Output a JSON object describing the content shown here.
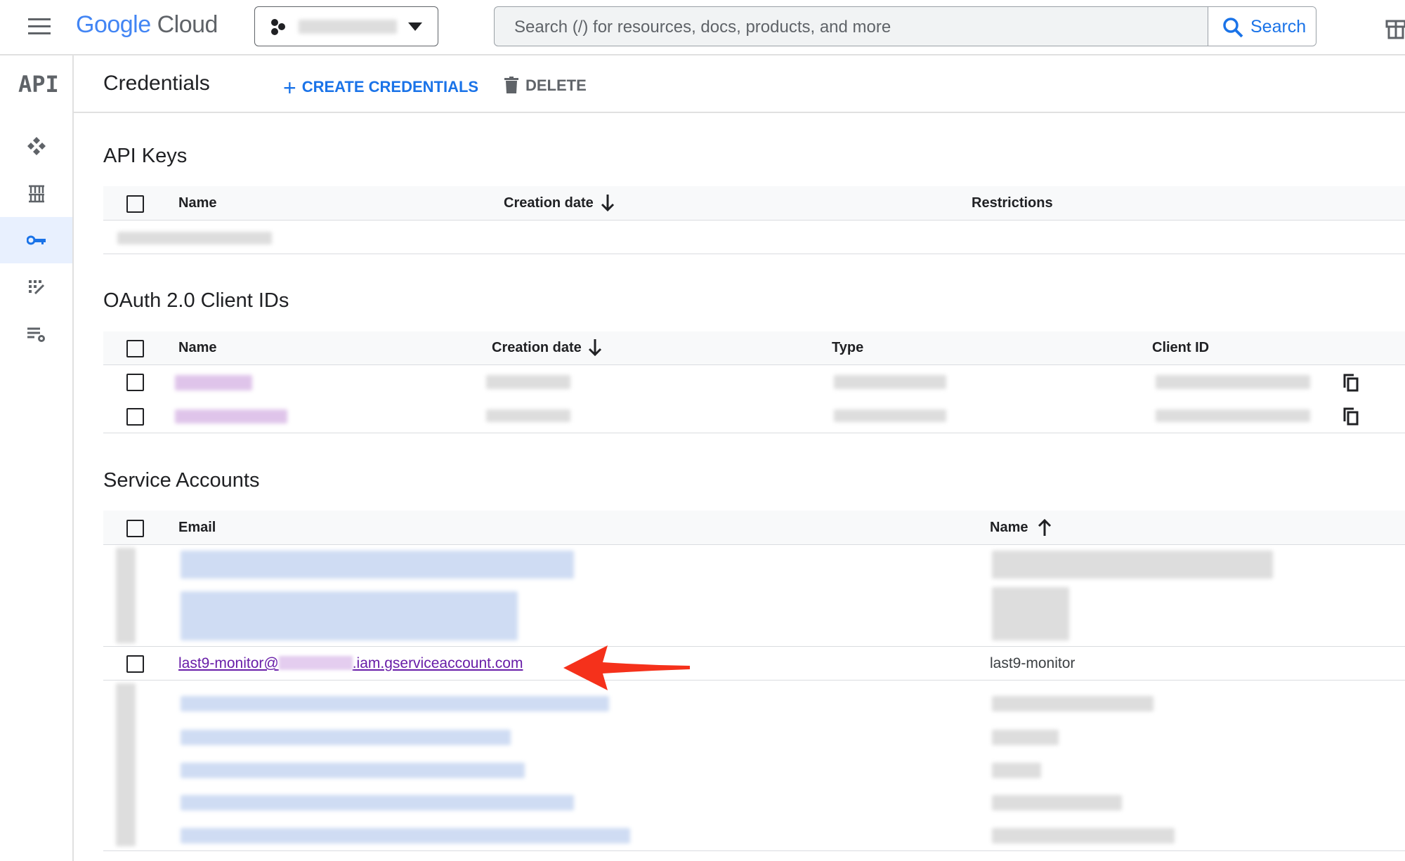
{
  "header": {
    "logo_google": "Google",
    "logo_cloud": "Cloud",
    "search_placeholder": "Search (/) for resources, docs, products, and more",
    "search_button": "Search"
  },
  "subbar": {
    "api_logo": "API",
    "title": "Credentials",
    "create_label": "CREATE CREDENTIALS",
    "delete_label": "DELETE"
  },
  "sidebar": {
    "items": [
      "dashboard",
      "library",
      "credentials",
      "oauth-consent",
      "page-usage-agreements"
    ]
  },
  "api_keys": {
    "title": "API Keys",
    "columns": [
      "Name",
      "Creation date",
      "Restrictions"
    ]
  },
  "oauth": {
    "title": "OAuth 2.0 Client IDs",
    "columns": [
      "Name",
      "Creation date",
      "Type",
      "Client ID"
    ]
  },
  "service_accounts": {
    "title": "Service Accounts",
    "columns": [
      "Email",
      "Name"
    ],
    "highlighted": {
      "email_prefix": "last9-monitor@",
      "email_suffix": ".iam.gserviceaccount.com",
      "name": "last9-monitor"
    }
  },
  "colors": {
    "accent": "#1a73e8",
    "link_visited": "#681da8",
    "annotation_arrow": "#f5311b"
  }
}
